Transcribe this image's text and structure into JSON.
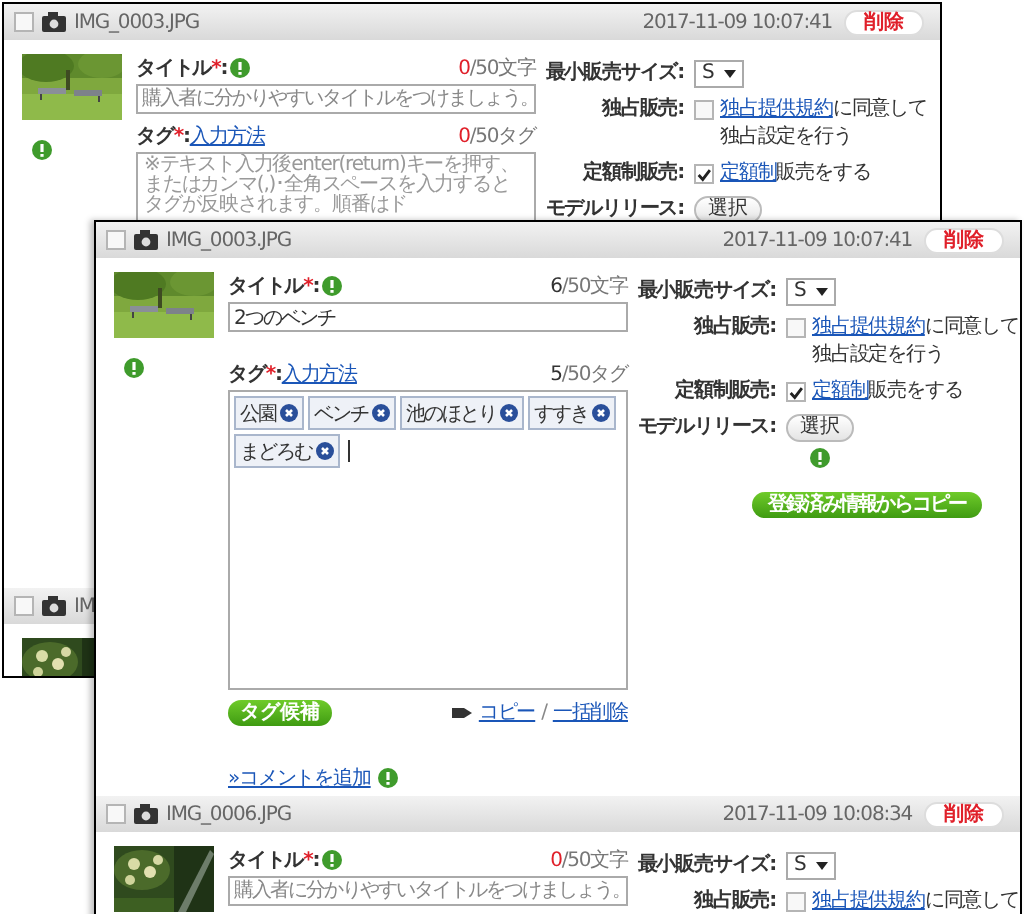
{
  "windows": [
    {
      "kind": "back",
      "records": [
        {
          "checked": false,
          "file_name": "IMG_0003.JPG",
          "date": "2017-11-09 10:07:41",
          "delete_label": "削除",
          "thumbnail": {
            "kind": "picture"
          },
          "title_label": {
            "text": "タイトル",
            "mark": "*",
            "colon": ":"
          },
          "title_count": {
            "count": "0",
            "limit": "/50文字",
            "warning": true
          },
          "title_field": {
            "placeholder": "購入者に分かりやすいタイトルをつけましょう。"
          },
          "tags_label": {
            "text": "タグ",
            "mark": "*",
            "colon": ":",
            "link": "入力方法"
          },
          "tags_count": {
            "count": "0",
            "limit": "/50タグ",
            "warning": true
          },
          "tags_field": {
            "placeholder": "※テキスト入力後enter(return)キーを押す、またはカンマ(,)･全角スペースを入力するとタグが反映されます。順番はド"
          },
          "settings": [
            {
              "kind": "select",
              "label": "最小販売サイズ:",
              "value": "S"
            },
            {
              "kind": "checkbox",
              "label": "独占販売:",
              "checked": false,
              "link": "独占提供規約",
              "text": "に同意して",
              "text_line_2": "独占設定を行う"
            },
            {
              "kind": "checkbox",
              "label": "定額制販売:",
              "checked": true,
              "link": "定額制",
              "text": "販売をする"
            },
            {
              "kind": "button",
              "label": "モデルリリース:",
              "button": "選択"
            }
          ]
        },
        {
          "checked": false,
          "file_name": "IM",
          "thumbnail": {
            "kind": "picture"
          }
        }
      ]
    },
    {
      "kind": "front",
      "records": [
        {
          "checked": false,
          "file_name": "IMG_0003.JPG",
          "date": "2017-11-09 10:07:41",
          "delete_label": "削除",
          "thumbnail": {
            "kind": "picture"
          },
          "title_label": {
            "text": "タイトル",
            "mark": "*",
            "colon": ":"
          },
          "title_count": {
            "count": "6",
            "limit": "/50文字",
            "warning": false
          },
          "title_field": {
            "value": "2つのベンチ"
          },
          "tags_label": {
            "text": "タグ",
            "mark": "*",
            "colon": ":",
            "link": "入力方法"
          },
          "tags_count": {
            "count": "5",
            "limit": "/50タグ",
            "warning": false
          },
          "tags_field": {
            "tags": [
              "公園",
              "ベンチ",
              "池のほとり",
              "すすき",
              "まどろむ"
            ]
          },
          "tag_suggest_button": "タグ候補",
          "tag_actions": {
            "copy": "コピー",
            "separator": "/",
            "clear": "一括削除"
          },
          "comment_link": "»コメントを追加",
          "settings": [
            {
              "kind": "select",
              "label": "最小販売サイズ:",
              "value": "S"
            },
            {
              "kind": "checkbox",
              "label": "独占販売:",
              "checked": false,
              "link": "独占提供規約",
              "text": "に同意して",
              "text_line_2": "独占設定を行う"
            },
            {
              "kind": "checkbox",
              "label": "定額制販売:",
              "checked": true,
              "link": "定額制",
              "text": "販売をする"
            },
            {
              "kind": "button",
              "label": "モデルリリース:",
              "button": "選択",
              "info": true
            }
          ],
          "copy_button": "登録済み情報からコピー"
        },
        {
          "checked": false,
          "file_name": "IMG_0006.JPG",
          "date": "2017-11-09 10:08:34",
          "delete_label": "削除",
          "thumbnail": {
            "kind": "picture"
          },
          "title_label": {
            "text": "タイトル",
            "mark": "*",
            "colon": ":"
          },
          "title_count": {
            "count": "0",
            "limit": "/50文字",
            "warning": true
          },
          "title_field": {
            "placeholder": "購入者に分かりやすいタイトルをつけましょう。"
          },
          "settings": [
            {
              "kind": "select",
              "label": "最小販売サイズ:",
              "value": "S"
            },
            {
              "kind": "checkbox",
              "label": "独占販売:",
              "checked": false,
              "link": "独占提供規約",
              "text": "に同意して"
            }
          ]
        }
      ]
    }
  ]
}
